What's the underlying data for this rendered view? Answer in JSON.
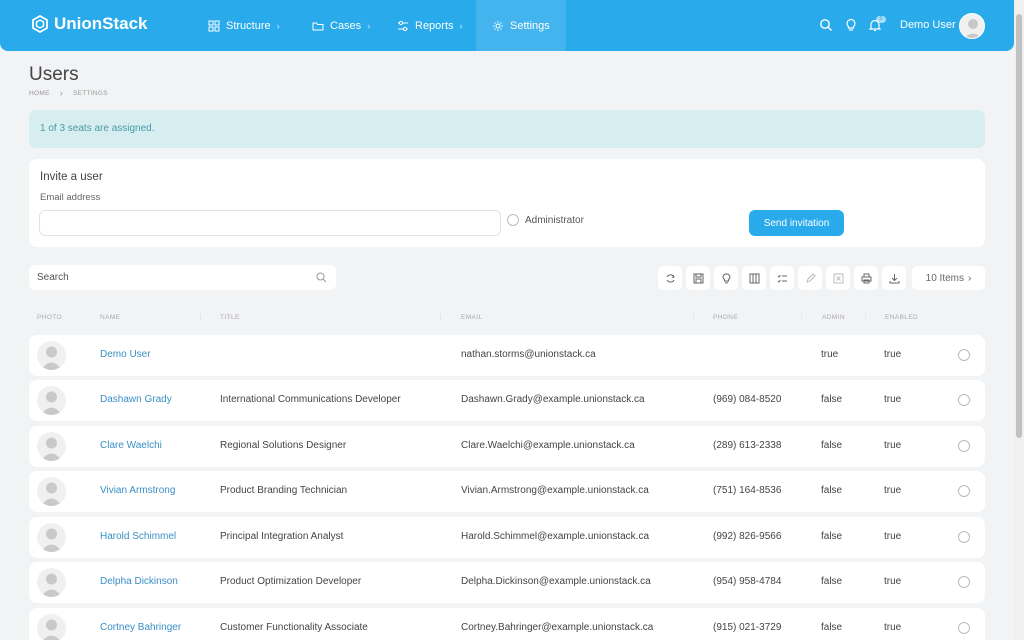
{
  "app": {
    "name": "UnionStack"
  },
  "nav": {
    "items": [
      {
        "label": "Structure",
        "icon": "grid-icon"
      },
      {
        "label": "Cases",
        "icon": "folder-icon"
      },
      {
        "label": "Reports",
        "icon": "sliders-icon"
      },
      {
        "label": "Settings",
        "icon": "gear-icon"
      }
    ],
    "notification_count": "0",
    "user_name": "Demo User"
  },
  "page": {
    "title": "Users",
    "breadcrumb": [
      "HOME",
      "SETTINGS"
    ]
  },
  "alert": {
    "text": "1 of 3 seats are assigned."
  },
  "invite": {
    "title": "Invite a user",
    "email_label": "Email address",
    "email_value": "",
    "admin_label": "Administrator",
    "send_label": "Send invitation"
  },
  "search": {
    "placeholder": "Search"
  },
  "items_label": "10 Items",
  "table": {
    "columns": [
      "PHOTO",
      "NAME",
      "TITLE",
      "EMAIL",
      "PHONE",
      "ADMIN",
      "ENABLED"
    ],
    "rows": [
      {
        "name": "Demo User",
        "title": "",
        "email": "nathan.storms@unionstack.ca",
        "phone": "",
        "admin": "true",
        "enabled": "true"
      },
      {
        "name": "Dashawn Grady",
        "title": "International Communications Developer",
        "email": "Dashawn.Grady@example.unionstack.ca",
        "phone": "(969) 084-8520",
        "admin": "false",
        "enabled": "true"
      },
      {
        "name": "Clare Waelchi",
        "title": "Regional Solutions Designer",
        "email": "Clare.Waelchi@example.unionstack.ca",
        "phone": "(289) 613-2338",
        "admin": "false",
        "enabled": "true"
      },
      {
        "name": "Vivian Armstrong",
        "title": "Product Branding Technician",
        "email": "Vivian.Armstrong@example.unionstack.ca",
        "phone": "(751) 164-8536",
        "admin": "false",
        "enabled": "true"
      },
      {
        "name": "Harold Schimmel",
        "title": "Principal Integration Analyst",
        "email": "Harold.Schimmel@example.unionstack.ca",
        "phone": "(992) 826-9566",
        "admin": "false",
        "enabled": "true"
      },
      {
        "name": "Delpha Dickinson",
        "title": "Product Optimization Developer",
        "email": "Delpha.Dickinson@example.unionstack.ca",
        "phone": "(954) 958-4784",
        "admin": "false",
        "enabled": "true"
      },
      {
        "name": "Cortney Bahringer",
        "title": "Customer Functionality Associate",
        "email": "Cortney.Bahringer@example.unionstack.ca",
        "phone": "(915) 021-3729",
        "admin": "false",
        "enabled": "true"
      }
    ]
  },
  "colors": {
    "primary": "#29aaeb",
    "link": "#3a8fc6",
    "alert_bg": "#d6eef0",
    "alert_text": "#4a9aa8"
  }
}
